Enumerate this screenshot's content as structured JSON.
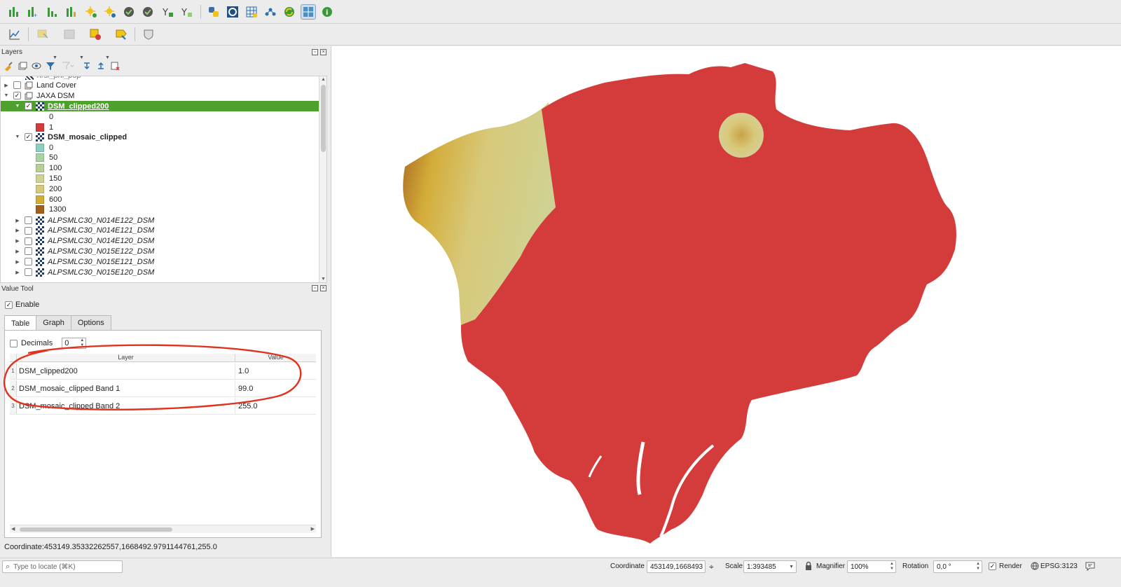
{
  "panels": {
    "layers_title": "Layers",
    "value_tool_title": "Value Tool"
  },
  "layers": {
    "cut_top_label": "hrsl_phl_pop",
    "land_cover": "Land Cover",
    "jaxa_group": "JAXA DSM",
    "clipped200": "DSM_clipped200",
    "clipped200_classes": [
      {
        "label": "0",
        "color": "#ffffff"
      },
      {
        "label": "1",
        "color": "#d43c3c"
      }
    ],
    "mosaic": "DSM_mosaic_clipped",
    "mosaic_classes": [
      {
        "label": "0",
        "color": "#8ccfc0"
      },
      {
        "label": "50",
        "color": "#a9d2a3"
      },
      {
        "label": "100",
        "color": "#b5cf97"
      },
      {
        "label": "150",
        "color": "#cfd292"
      },
      {
        "label": "200",
        "color": "#d8c879"
      },
      {
        "label": "600",
        "color": "#d3ad3a"
      },
      {
        "label": "1300",
        "color": "#a45f1c"
      }
    ],
    "alps": [
      "ALPSMLC30_N014E122_DSM",
      "ALPSMLC30_N014E121_DSM",
      "ALPSMLC30_N014E120_DSM",
      "ALPSMLC30_N015E122_DSM",
      "ALPSMLC30_N015E121_DSM",
      "ALPSMLC30_N015E120_DSM"
    ]
  },
  "value_tool": {
    "enable_label": "Enable",
    "tabs": [
      "Table",
      "Graph",
      "Options"
    ],
    "decimals_label": "Decimals",
    "decimals_value": "0",
    "col_layer": "Layer",
    "col_value": "Value",
    "rows": [
      {
        "num": "1",
        "layer": "DSM_clipped200",
        "value": "1.0"
      },
      {
        "num": "2",
        "layer": "DSM_mosaic_clipped Band 1",
        "value": "99.0"
      },
      {
        "num": "3",
        "layer": "DSM_mosaic_clipped Band 2",
        "value": "255.0"
      }
    ]
  },
  "coordinate_readout": "Coordinate:453149.35332262557,1668492.9791144761,255.0",
  "statusbar": {
    "locate_placeholder": "Type to locate (⌘K)",
    "coordinate_label": "Coordinate",
    "coordinate_value": "453149,1668493",
    "scale_label": "Scale",
    "scale_value": "1:393485",
    "magnifier_label": "Magnifier",
    "magnifier_value": "100%",
    "rotation_label": "Rotation",
    "rotation_value": "0,0 °",
    "render_label": "Render",
    "crs_label": "EPSG:3123"
  },
  "colors": {
    "selection": "#4ea12d",
    "map_red": "#d43c3c",
    "annotation_red": "#e0321e"
  }
}
